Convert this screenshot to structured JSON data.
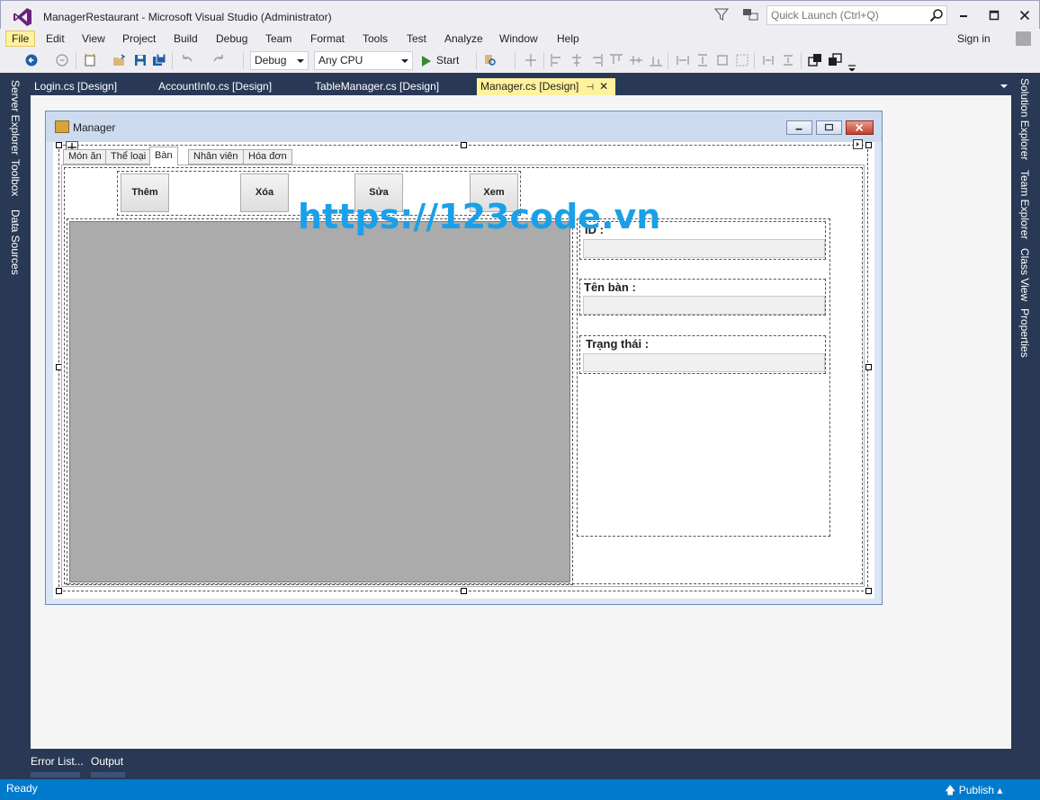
{
  "window": {
    "title": "ManagerRestaurant - Microsoft Visual Studio (Administrator)",
    "quick_launch_placeholder": "Quick Launch (Ctrl+Q)"
  },
  "menu": {
    "items": [
      "File",
      "Edit",
      "View",
      "Project",
      "Build",
      "Debug",
      "Team",
      "Format",
      "Tools",
      "Test",
      "Analyze",
      "Window",
      "Help"
    ],
    "sign_in": "Sign in"
  },
  "toolbar": {
    "config": "Debug",
    "platform": "Any CPU",
    "start": "Start"
  },
  "side_panels": {
    "left": [
      "Server Explorer",
      "Toolbox",
      "Data Sources"
    ],
    "right": [
      "Solution Explorer",
      "Team Explorer",
      "Class View",
      "Properties"
    ]
  },
  "doc_tabs": [
    "Login.cs [Design]",
    "AccountInfo.cs [Design]",
    "TableManager.cs [Design]",
    "Manager.cs [Design]"
  ],
  "form": {
    "title": "Manager",
    "tabs": [
      "Món ăn",
      "Thể loại",
      "Bàn",
      "Nhân viên",
      "Hóa đơn"
    ],
    "selected_tab": "Bàn",
    "buttons": [
      "Thêm",
      "Xóa",
      "Sửa",
      "Xem"
    ],
    "fields": [
      "ID :",
      "Tên bàn :",
      "Trạng thái :"
    ]
  },
  "watermark": "https://123code.vn",
  "bottom_tabs": [
    "Error List...",
    "Output"
  ],
  "status": {
    "text": "Ready",
    "publish": "Publish"
  },
  "colors": {
    "accent": "#007acc",
    "frame": "#293955",
    "active_tab": "#fff29d",
    "watermark": "#1aa0e8"
  }
}
